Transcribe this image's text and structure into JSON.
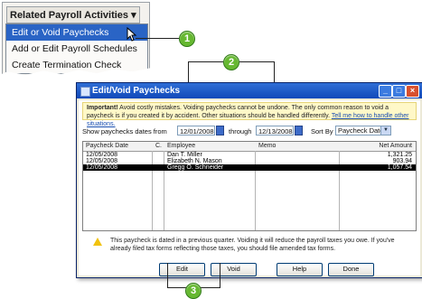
{
  "menu": {
    "header": "Related Payroll Activities ▾",
    "items": [
      {
        "label": "Edit or Void Paychecks",
        "selected": true
      },
      {
        "label": "Add or Edit Payroll Schedules",
        "selected": false
      },
      {
        "label": "Create Termination Check",
        "selected": false
      }
    ]
  },
  "callouts": [
    "1",
    "2",
    "3"
  ],
  "dialog": {
    "title": "Edit/Void Paychecks",
    "notice": {
      "bold": "Important!",
      "text": " Avoid costly mistakes. Voiding paychecks cannot be undone. The only common reason to void a paycheck is if you created it by accident. Other situations should be handled differently.",
      "link": "Tell me how to handle other situations."
    },
    "filter": {
      "show_label": "Show paychecks dates from",
      "from": "12/01/2008",
      "through_label": "through",
      "to": "12/13/2008",
      "sort_label": "Sort By",
      "sort_value": "Paycheck Date"
    },
    "table": {
      "headers": [
        "Paycheck Date",
        "C.",
        "Employee",
        "Memo",
        "Net Amount"
      ],
      "rows": [
        {
          "date": "12/05/2008",
          "c": "",
          "employee": "Dan T. Miller",
          "memo": "",
          "net": "1,321.25",
          "selected": false
        },
        {
          "date": "12/05/2008",
          "c": "",
          "employee": "Elizabeth N. Mason",
          "memo": "",
          "net": "903.94",
          "selected": false
        },
        {
          "date": "12/05/2008",
          "c": "",
          "employee": "Gregg O. Schneider",
          "memo": "",
          "net": "1,057.54",
          "selected": true
        }
      ]
    },
    "warning": "This paycheck is dated in a previous quarter. Voiding it will reduce the payroll taxes you owe. If you've already filed tax forms reflecting those taxes, you should file amended tax forms.",
    "buttons": {
      "edit": "Edit",
      "void": "Void",
      "help": "Help",
      "done": "Done"
    }
  },
  "colors": {
    "accent": "#66b831",
    "title": "#1149b9",
    "selection": "#2a64c5"
  }
}
